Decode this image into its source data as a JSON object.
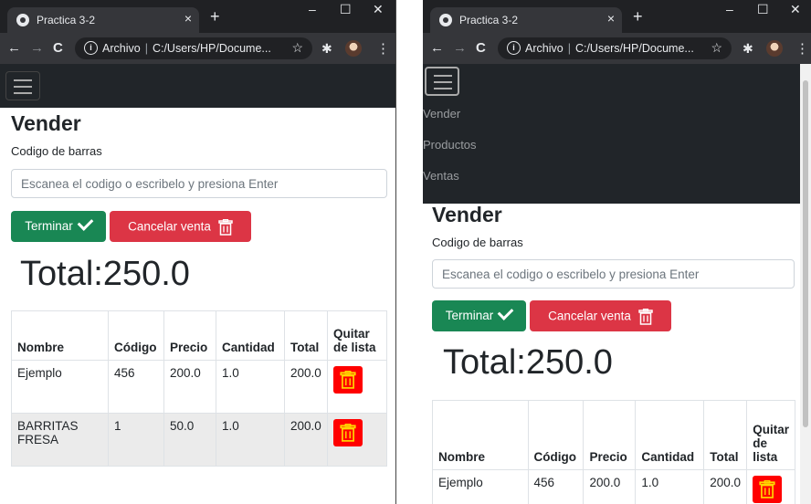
{
  "browser": {
    "tab_title": "Practica 3-2",
    "tab_close": "×",
    "new_tab": "+",
    "address_prefix": "Archivo",
    "address_path": "C:/Users/HP/Docume...",
    "minimize": "–",
    "maximize": "☐",
    "close": "✕"
  },
  "nav": {
    "links": [
      "Vender",
      "Productos",
      "Ventas"
    ]
  },
  "page": {
    "title": "Vender",
    "barcode_label": "Codigo de barras",
    "barcode_placeholder": "Escanea el codigo o escribelo y presiona Enter",
    "finish_label": "Terminar",
    "cancel_label": "Cancelar venta",
    "total_text": "Total:250.0"
  },
  "table": {
    "headers": [
      "Nombre",
      "Código",
      "Precio",
      "Cantidad",
      "Total",
      "Quitar de lista"
    ],
    "rows": [
      [
        "Ejemplo",
        "456",
        "200.0",
        "1.0",
        "200.0"
      ],
      [
        "BARRITAS FRESA",
        "1",
        "50.0",
        "1.0",
        "200.0"
      ]
    ]
  },
  "colors": {
    "success": "#198754",
    "danger": "#dc3545",
    "remove": "#ff0000",
    "navbar": "#212529"
  }
}
